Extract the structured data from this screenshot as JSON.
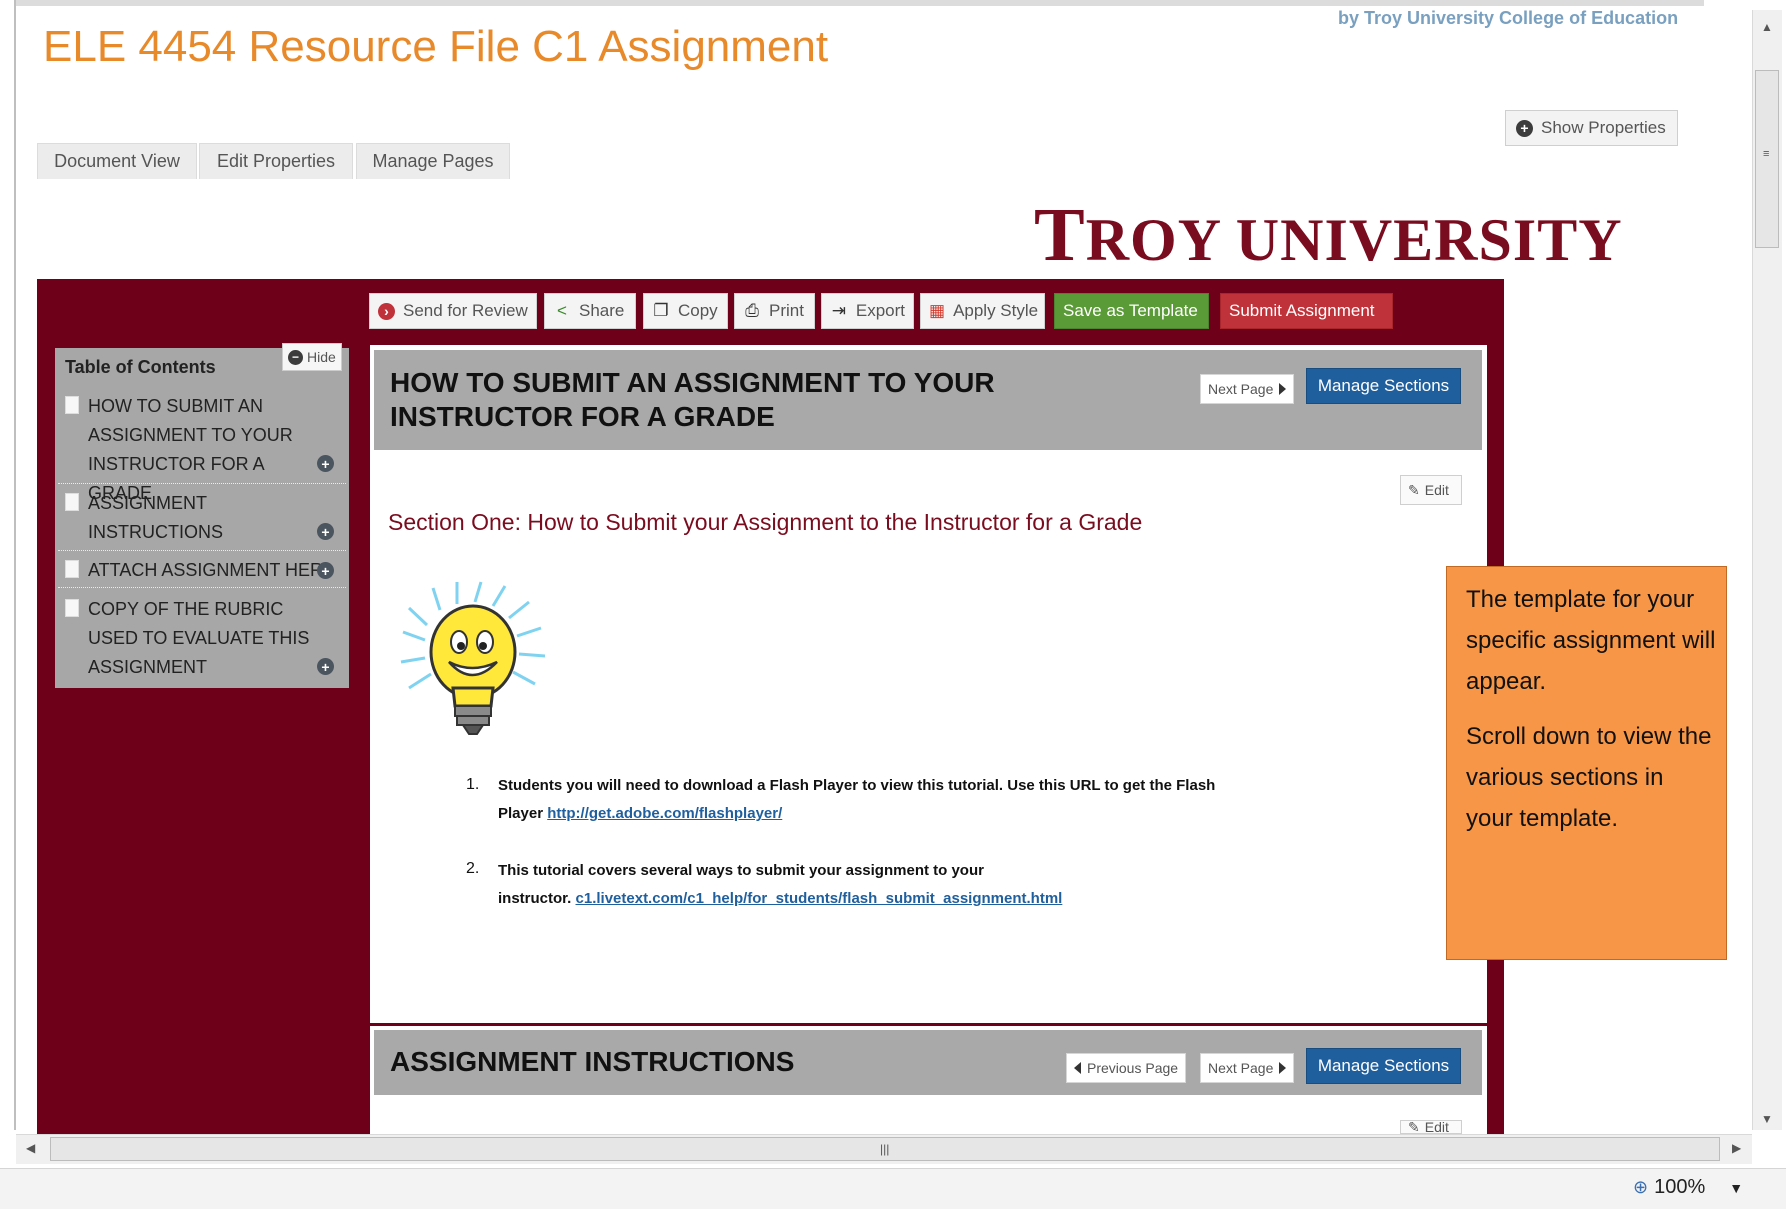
{
  "app": {
    "title": "ELE 4454 Resource File C1 Assignment",
    "byline": "by Troy University College of Education",
    "show_properties": "Show Properties"
  },
  "tabs": [
    {
      "label": "Document View"
    },
    {
      "label": "Edit Properties"
    },
    {
      "label": "Manage Pages"
    }
  ],
  "logo": {
    "big": "T",
    "rest": "ROY UNIVERSITY"
  },
  "toolbar": {
    "send_for_review": "Send for Review",
    "share": "Share",
    "copy": "Copy",
    "print": "Print",
    "export": "Export",
    "apply_style": "Apply Style",
    "save_as_template": "Save as Template",
    "submit_assignment": "Submit Assignment"
  },
  "toc": {
    "title": "Table of Contents",
    "hide": "Hide",
    "items": [
      {
        "label": "HOW TO SUBMIT AN ASSIGNMENT TO YOUR INSTRUCTOR FOR A GRADE"
      },
      {
        "label": "ASSIGNMENT INSTRUCTIONS"
      },
      {
        "label": "ATTACH ASSIGNMENT HERE"
      },
      {
        "label": "COPY OF THE RUBRIC USED TO EVALUATE THIS ASSIGNMENT"
      }
    ]
  },
  "sections": [
    {
      "title_line1": "HOW TO SUBMIT AN ASSIGNMENT TO YOUR",
      "title_line2": "INSTRUCTOR FOR A GRADE",
      "next_page": "Next Page",
      "manage_sections": "Manage Sections",
      "edit": "Edit",
      "heading": "Section One: How to Submit your Assignment to the Instructor for a Grade",
      "list": [
        {
          "num": "1.",
          "line1": "Students you will need to download a Flash Player to view this tutorial.  Use this URL to get the Flash",
          "line2_prefix": "Player ",
          "link": "http://get.adobe.com/flashplayer/"
        },
        {
          "num": "2.",
          "line1": "This tutorial covers several ways to submit your assignment to your",
          "line2_prefix": "instructor. ",
          "link": "c1.livetext.com/c1_help/for_students/flash_submit_assignment.html"
        }
      ]
    },
    {
      "title": "ASSIGNMENT INSTRUCTIONS",
      "previous_page": "Previous Page",
      "next_page": "Next Page",
      "manage_sections": "Manage Sections",
      "edit": "Edit"
    }
  ],
  "callout": {
    "p1": "The template for your specific assignment will appear.",
    "p2": "Scroll down to view the various sections in your template."
  },
  "status": {
    "zoom": "100%"
  },
  "colors": {
    "accent": "#e8892a",
    "maroon": "#6e0019",
    "callout": "#f79646",
    "manage_blue": "#1f5f9e"
  },
  "icons": [
    "minus-circle-icon",
    "plus-circle-icon",
    "share-icon",
    "copy-icon",
    "print-icon",
    "export-icon",
    "apply-style-icon",
    "pencil-icon",
    "document-icon",
    "lightbulb-icon",
    "zoom-icon"
  ]
}
